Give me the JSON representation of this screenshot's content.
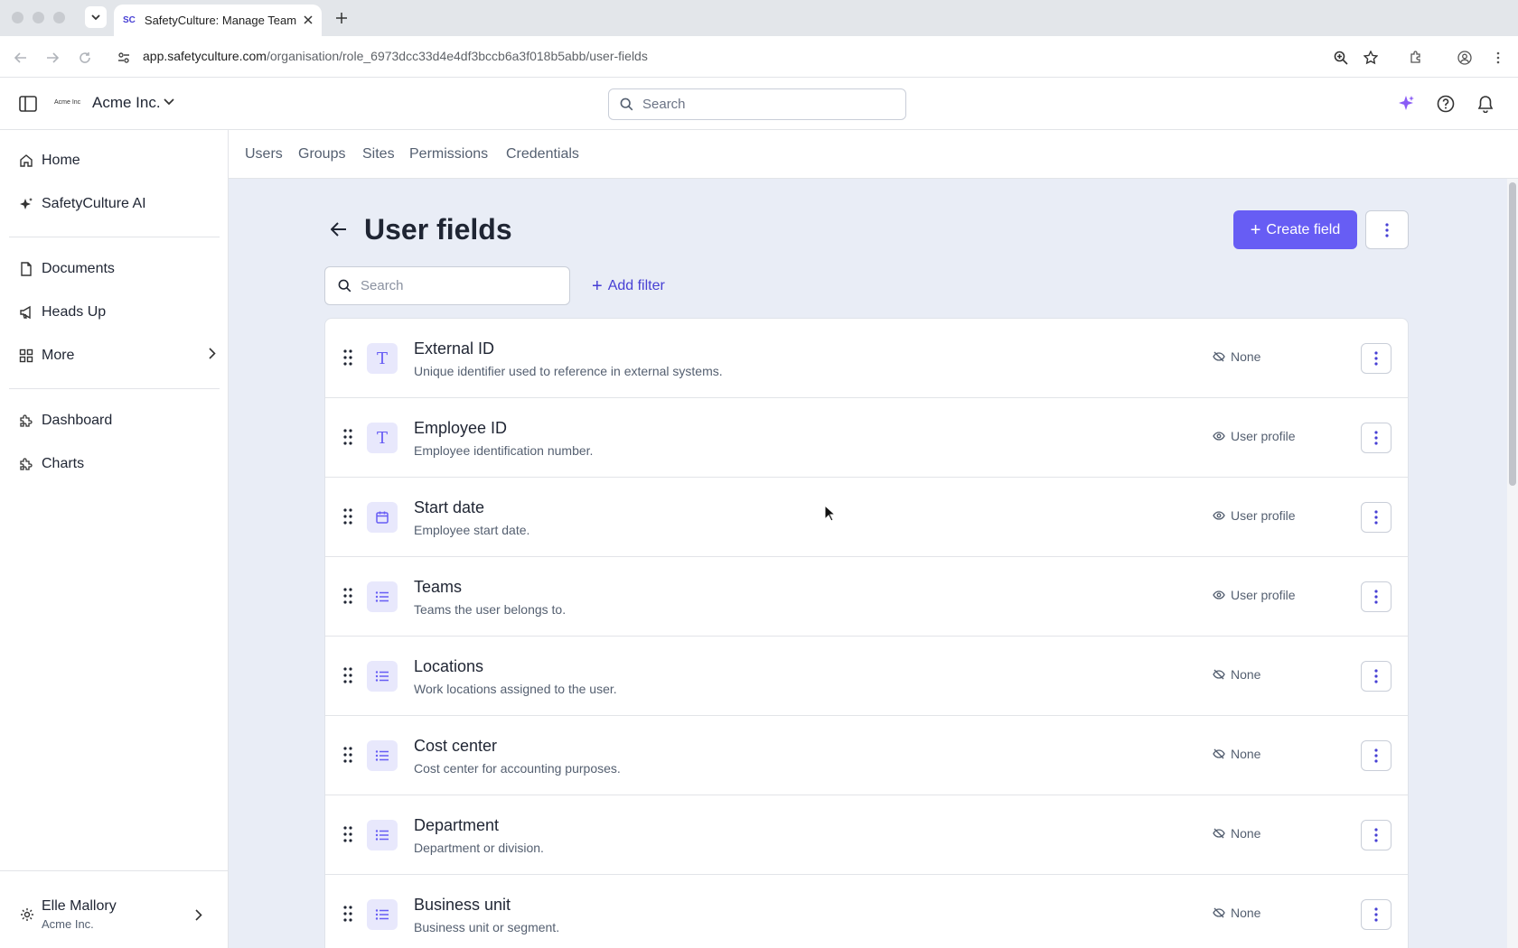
{
  "browser": {
    "tab_title": "SafetyCulture: Manage Teams",
    "tab_favicon": "SC",
    "url_host": "app.safetyculture.com",
    "url_path": "/organisation/role_6973dcc33d4e4df3bccb6a3f018b5abb/user-fields"
  },
  "header": {
    "org_logo": "Acme Inc",
    "org_name": "Acme Inc.",
    "search_placeholder": "Search"
  },
  "sidebar": {
    "items": [
      {
        "label": "Home",
        "icon": "home-icon"
      },
      {
        "label": "SafetyCulture AI",
        "icon": "sparkle-icon"
      },
      {
        "label": "Documents",
        "icon": "document-icon"
      },
      {
        "label": "Heads Up",
        "icon": "megaphone-icon"
      },
      {
        "label": "More",
        "icon": "grid-icon"
      },
      {
        "label": "Dashboard",
        "icon": "puzzle-icon"
      },
      {
        "label": "Charts",
        "icon": "puzzle-icon"
      }
    ],
    "user": {
      "name": "Elle Mallory",
      "org": "Acme Inc."
    }
  },
  "subnav": {
    "tabs": [
      "Users",
      "Groups",
      "Sites",
      "Permissions",
      "Credentials"
    ]
  },
  "page": {
    "title": "User fields",
    "create_label": "Create field",
    "search_placeholder": "Search",
    "add_filter_label": "Add filter"
  },
  "fields": [
    {
      "name": "External ID",
      "description": "Unique identifier used to reference in external systems.",
      "type_icon": "text-type-icon",
      "visibility": "None",
      "visible": false
    },
    {
      "name": "Employee ID",
      "description": "Employee identification number.",
      "type_icon": "text-type-icon",
      "visibility": "User profile",
      "visible": true
    },
    {
      "name": "Start date",
      "description": "Employee start date.",
      "type_icon": "calendar-icon",
      "visibility": "User profile",
      "visible": true
    },
    {
      "name": "Teams",
      "description": "Teams the user belongs to.",
      "type_icon": "list-icon",
      "visibility": "User profile",
      "visible": true
    },
    {
      "name": "Locations",
      "description": "Work locations assigned to the user.",
      "type_icon": "list-icon",
      "visibility": "None",
      "visible": false
    },
    {
      "name": "Cost center",
      "description": "Cost center for accounting purposes.",
      "type_icon": "list-icon",
      "visibility": "None",
      "visible": false
    },
    {
      "name": "Department",
      "description": "Department or division.",
      "type_icon": "list-icon",
      "visibility": "None",
      "visible": false
    },
    {
      "name": "Business unit",
      "description": "Business unit or segment.",
      "type_icon": "list-icon",
      "visibility": "None",
      "visible": false
    }
  ],
  "colors": {
    "accent": "#675df4",
    "accent_text": "#4740d4",
    "main_bg": "#e9edf6"
  }
}
